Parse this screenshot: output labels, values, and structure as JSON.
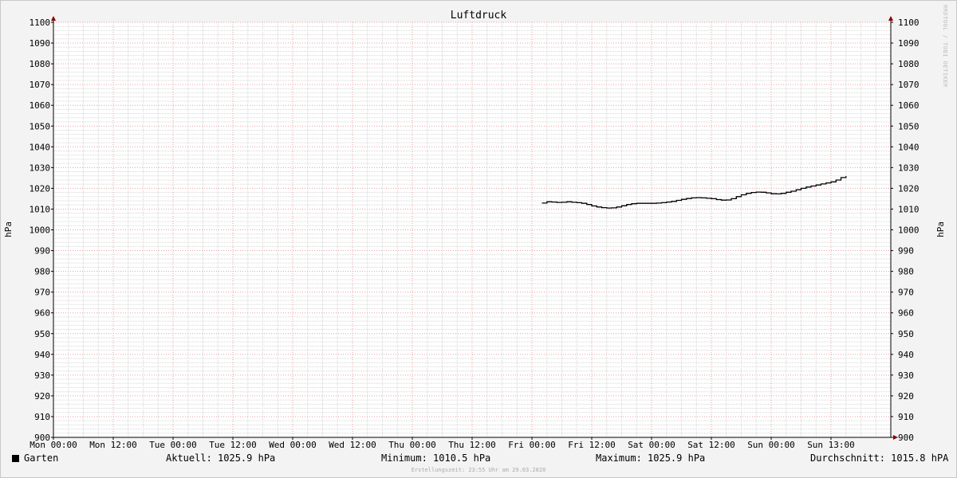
{
  "chart_data": {
    "type": "line",
    "title": "Luftdruck",
    "ylabel_left": "hPa",
    "ylabel_right": "hPa",
    "ylim": [
      900,
      1100
    ],
    "y_ticks": [
      900,
      910,
      920,
      930,
      940,
      950,
      960,
      970,
      980,
      990,
      1000,
      1010,
      1020,
      1030,
      1040,
      1050,
      1060,
      1070,
      1080,
      1090,
      1100
    ],
    "x_ticks": [
      {
        "label": "Mon 00:00",
        "h": 0
      },
      {
        "label": "Mon 12:00",
        "h": 12
      },
      {
        "label": "Tue 00:00",
        "h": 24
      },
      {
        "label": "Tue 12:00",
        "h": 36
      },
      {
        "label": "Wed 00:00",
        "h": 48
      },
      {
        "label": "Wed 12:00",
        "h": 60
      },
      {
        "label": "Thu 00:00",
        "h": 72
      },
      {
        "label": "Thu 12:00",
        "h": 84
      },
      {
        "label": "Fri 00:00",
        "h": 96
      },
      {
        "label": "Fri 12:00",
        "h": 108
      },
      {
        "label": "Sat 00:00",
        "h": 120
      },
      {
        "label": "Sat 12:00",
        "h": 132
      },
      {
        "label": "Sun 00:00",
        "h": 144
      },
      {
        "label": "Sun 13:00",
        "h": 156
      }
    ],
    "xlim_hours": [
      0,
      168
    ],
    "series": [
      {
        "name": "Garten",
        "color": "#000000",
        "points": [
          [
            98.0,
            1012.9
          ],
          [
            99.0,
            1013.5
          ],
          [
            100.0,
            1013.4
          ],
          [
            101.0,
            1013.2
          ],
          [
            102.0,
            1013.3
          ],
          [
            103.0,
            1013.5
          ],
          [
            104.0,
            1013.3
          ],
          [
            105.0,
            1013.1
          ],
          [
            106.0,
            1012.8
          ],
          [
            107.0,
            1012.2
          ],
          [
            108.0,
            1011.5
          ],
          [
            109.0,
            1011.0
          ],
          [
            110.0,
            1010.7
          ],
          [
            111.0,
            1010.5
          ],
          [
            112.0,
            1010.6
          ],
          [
            113.0,
            1011.0
          ],
          [
            114.0,
            1011.6
          ],
          [
            115.0,
            1012.2
          ],
          [
            116.0,
            1012.6
          ],
          [
            117.0,
            1012.8
          ],
          [
            118.0,
            1012.8
          ],
          [
            119.0,
            1012.8
          ],
          [
            120.0,
            1012.8
          ],
          [
            121.0,
            1012.9
          ],
          [
            122.0,
            1013.1
          ],
          [
            123.0,
            1013.4
          ],
          [
            124.0,
            1013.7
          ],
          [
            125.0,
            1014.2
          ],
          [
            126.0,
            1014.7
          ],
          [
            127.0,
            1015.1
          ],
          [
            128.0,
            1015.4
          ],
          [
            129.0,
            1015.5
          ],
          [
            130.0,
            1015.4
          ],
          [
            131.0,
            1015.2
          ],
          [
            132.0,
            1015.0
          ],
          [
            133.0,
            1014.6
          ],
          [
            134.0,
            1014.3
          ],
          [
            135.0,
            1014.4
          ],
          [
            136.0,
            1015.0
          ],
          [
            137.0,
            1016.0
          ],
          [
            138.0,
            1016.9
          ],
          [
            139.0,
            1017.6
          ],
          [
            140.0,
            1018.0
          ],
          [
            141.0,
            1018.2
          ],
          [
            142.0,
            1018.1
          ],
          [
            143.0,
            1017.8
          ],
          [
            144.0,
            1017.4
          ],
          [
            145.0,
            1017.3
          ],
          [
            146.0,
            1017.6
          ],
          [
            147.0,
            1018.1
          ],
          [
            148.0,
            1018.6
          ],
          [
            149.0,
            1019.3
          ],
          [
            150.0,
            1020.0
          ],
          [
            151.0,
            1020.6
          ],
          [
            152.0,
            1021.1
          ],
          [
            153.0,
            1021.6
          ],
          [
            154.0,
            1022.1
          ],
          [
            155.0,
            1022.6
          ],
          [
            156.0,
            1023.1
          ],
          [
            157.0,
            1024.0
          ],
          [
            158.0,
            1025.2
          ],
          [
            159.0,
            1025.9
          ]
        ]
      }
    ]
  },
  "legend": {
    "series_label": "Garten",
    "current": "Aktuell: 1025.9 hPa",
    "minimum": "Minimum: 1010.5 hPa",
    "maximum": "Maximum: 1025.9 hPa",
    "average": "Durchschnitt: 1015.8 hPA"
  },
  "footer": "Erstellungszeit: 23:55 Uhr am 29.03.2020",
  "watermark": "RRDTOOL / TOBI OETIKER",
  "colors": {
    "major_grid": "#e8a0a0",
    "minor_grid": "#d6d6d6",
    "axis": "#000000",
    "arrow": "#8b0000"
  }
}
